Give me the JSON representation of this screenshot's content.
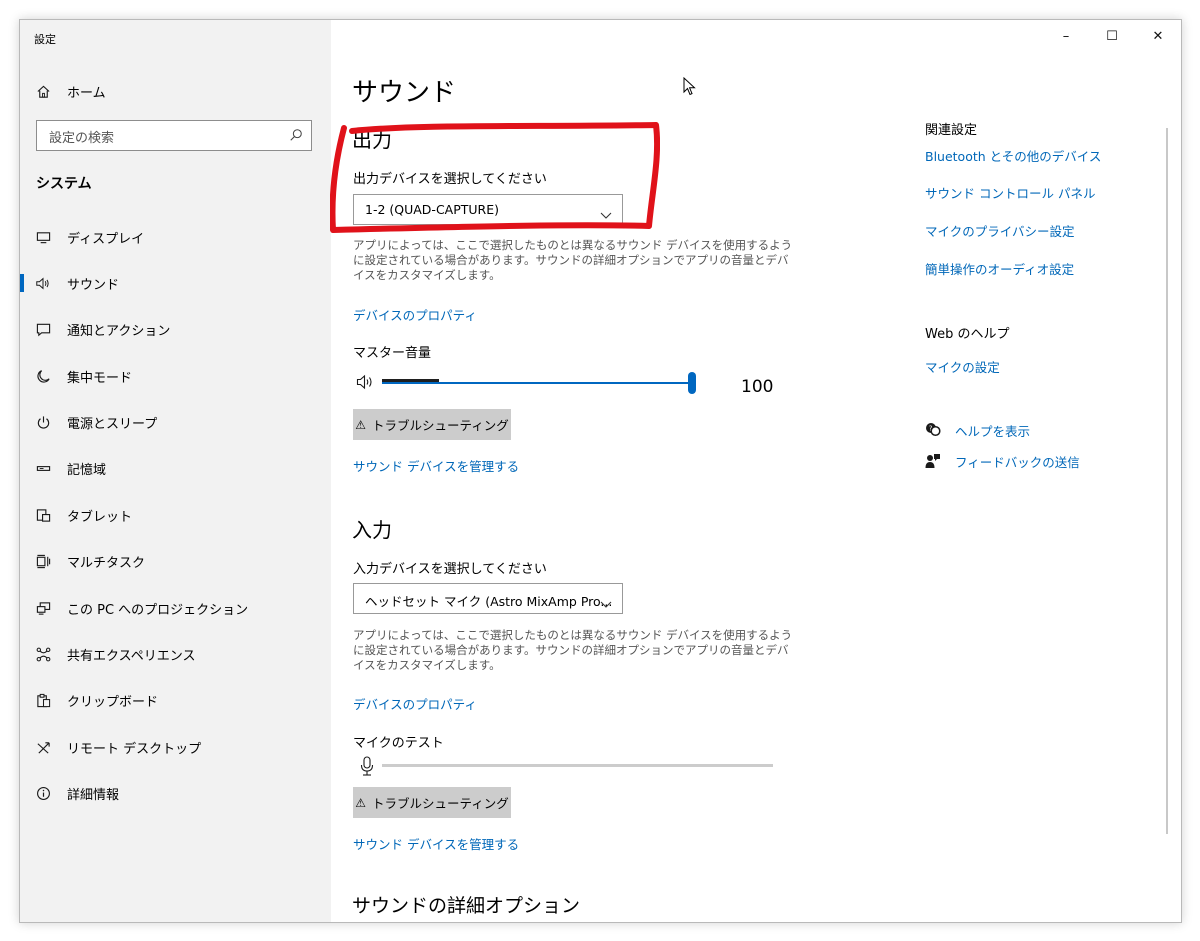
{
  "window": {
    "title": "設定",
    "controls": {
      "minimize": "–",
      "maximize": "☐",
      "close": "✕"
    }
  },
  "sidebar": {
    "home_label": "ホーム",
    "search_placeholder": "設定の検索",
    "section_label": "システム",
    "items": [
      {
        "label": "ディスプレイ",
        "icon": "display-icon"
      },
      {
        "label": "サウンド",
        "icon": "speaker-icon",
        "selected": true
      },
      {
        "label": "通知とアクション",
        "icon": "notification-icon"
      },
      {
        "label": "集中モード",
        "icon": "moon-icon"
      },
      {
        "label": "電源とスリープ",
        "icon": "power-icon"
      },
      {
        "label": "記憶域",
        "icon": "storage-icon"
      },
      {
        "label": "タブレット",
        "icon": "tablet-icon"
      },
      {
        "label": "マルチタスク",
        "icon": "multitask-icon"
      },
      {
        "label": "この PC へのプロジェクション",
        "icon": "projection-icon"
      },
      {
        "label": "共有エクスペリエンス",
        "icon": "shared-experience-icon"
      },
      {
        "label": "クリップボード",
        "icon": "clipboard-icon"
      },
      {
        "label": "リモート デスクトップ",
        "icon": "remote-desktop-icon"
      },
      {
        "label": "詳細情報",
        "icon": "info-icon"
      }
    ]
  },
  "main": {
    "title": "サウンド",
    "output": {
      "heading": "出力",
      "device_label": "出力デバイスを選択してください",
      "device_value": "1-2 (QUAD-CAPTURE)",
      "desc": "アプリによっては、ここで選択したものとは異なるサウンド デバイスを使用するように設定されている場合があります。サウンドの詳細オプションでアプリの音量とデバイスをカスタマイズします。",
      "properties_link": "デバイスのプロパティ",
      "volume_label": "マスター音量",
      "volume_value": "100",
      "volume_level": 100,
      "troubleshoot_label": "トラブルシューティング",
      "manage_link": "サウンド デバイスを管理する"
    },
    "input": {
      "heading": "入力",
      "device_label": "入力デバイスを選択してください",
      "device_value": "ヘッドセット マイク (Astro MixAmp Pro...",
      "desc": "アプリによっては、ここで選択したものとは異なるサウンド デバイスを使用するように設定されている場合があります。サウンドの詳細オプションでアプリの音量とデバイスをカスタマイズします。",
      "properties_link": "デバイスのプロパティ",
      "mic_test_label": "マイクのテスト",
      "mic_level": 0,
      "troubleshoot_label": "トラブルシューティング",
      "manage_link": "サウンド デバイスを管理する"
    },
    "advanced_heading": "サウンドの詳細オプション"
  },
  "related": {
    "heading": "関連設定",
    "links": [
      "Bluetooth とその他のデバイス",
      "サウンド コントロール パネル",
      "マイクのプライバシー設定",
      "簡単操作のオーディオ設定"
    ],
    "web_help_heading": "Web のヘルプ",
    "web_links": [
      "マイクの設定"
    ],
    "help_label": "ヘルプを表示",
    "feedback_label": "フィードバックの送信"
  },
  "colors": {
    "accent": "#0067b8",
    "annotation": "#e0121a",
    "sidebar_bg": "#f2f2f2"
  }
}
